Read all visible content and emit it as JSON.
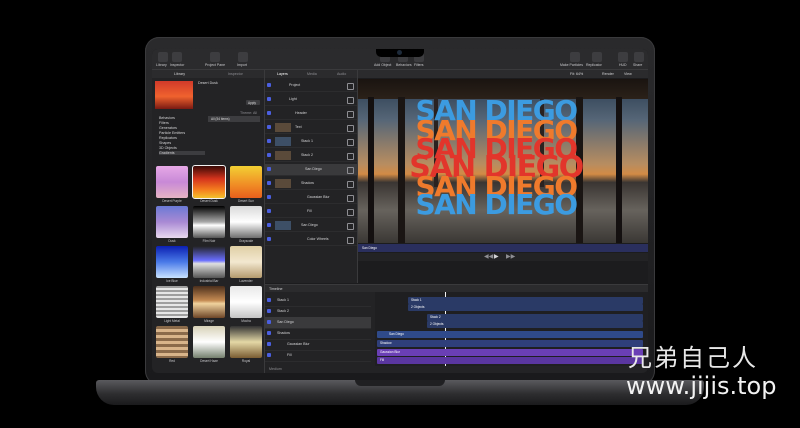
{
  "toolbar": {
    "left_buttons": [
      "Library",
      "Inspector"
    ],
    "mid_buttons": [
      "Project Pane",
      "Import"
    ],
    "center_buttons": [
      "Add Object",
      "Behaviors",
      "Filters"
    ],
    "right_buttons": [
      "Make Particles",
      "Replicator",
      "HUD",
      "Share"
    ]
  },
  "library": {
    "tabs": [
      "Library",
      "Inspector"
    ],
    "preview_name": "Desert Dusk",
    "apply_label": "Apply",
    "theme_label": "Theme: All",
    "categories": [
      "Behaviors",
      "Filters",
      "Generators",
      "Particle Emitters",
      "Replicators",
      "Shapes",
      "3D Objects",
      "Gradients"
    ],
    "subfolder": "All (54 items)",
    "gradients": [
      {
        "name": "Desert Purple"
      },
      {
        "name": "Desert Dusk"
      },
      {
        "name": "Desert Sun"
      },
      {
        "name": "Dusk"
      },
      {
        "name": "Film Noir"
      },
      {
        "name": "Grayscale"
      },
      {
        "name": "Ice Blue"
      },
      {
        "name": "Industrial Bar"
      },
      {
        "name": "Lavender"
      },
      {
        "name": "Light Metal"
      },
      {
        "name": "Mirage"
      },
      {
        "name": "Mocha"
      },
      {
        "name": "Red"
      },
      {
        "name": "Desert Haze"
      },
      {
        "name": "Royal"
      }
    ]
  },
  "layers_panel": {
    "tabs": [
      "Layers",
      "Media",
      "Audio"
    ],
    "rows": [
      "Project",
      "Light",
      "Header",
      "Text",
      "Stack 1",
      "Stack 2",
      "San Diego",
      "Shadow",
      "Gaussian Blur",
      "Fill",
      "San Diego",
      "Color Wheels"
    ]
  },
  "canvas": {
    "fit_label": "Fit: 64%",
    "render_label": "Render",
    "view_label": "View",
    "title_text": "SAN DIEGO",
    "bottom_label": "San Diego"
  },
  "timeline": {
    "header": "Timeline",
    "rows": [
      "Stack 1",
      "Stack 2",
      "San Diego",
      "Shadow",
      "Gaussian Blur",
      "Fill"
    ],
    "tracks": [
      "Stack 1",
      "2 Objects",
      "Stack 2",
      "2 Objects",
      "San Diego",
      "Shadow",
      "Gaussian Blur",
      "Fill"
    ],
    "footer": "Medium"
  },
  "watermark": {
    "brand": "兄弟自己人",
    "url": "www.jijis.top"
  },
  "colors": {
    "accent": "#4b5fe0",
    "title_blue": "#3c9be0",
    "title_red": "#e2352b",
    "title_orange": "#ef7a2c"
  }
}
